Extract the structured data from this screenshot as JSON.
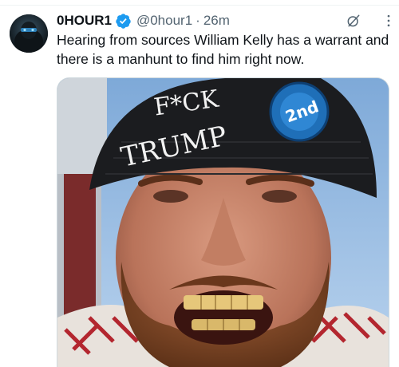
{
  "tweet": {
    "author": {
      "display_name": "0HOUR1",
      "handle": "@0hour1",
      "verified": true,
      "avatar_icon": "masked-figure-avatar"
    },
    "separator": "·",
    "timestamp": "26m",
    "text": "Hearing from sources William Kelly has a warrant and there is a manhunt to find him right now.",
    "icons": {
      "grok": "grok-icon",
      "more": "more-options-icon"
    },
    "media": {
      "beanie_text_line1": "F*CK",
      "beanie_text_line2": "TRUMP",
      "pin_text": "2nd"
    }
  },
  "colors": {
    "verified_blue": "#1d9bf0",
    "secondary_text": "#536471",
    "primary_text": "#0f1419"
  }
}
